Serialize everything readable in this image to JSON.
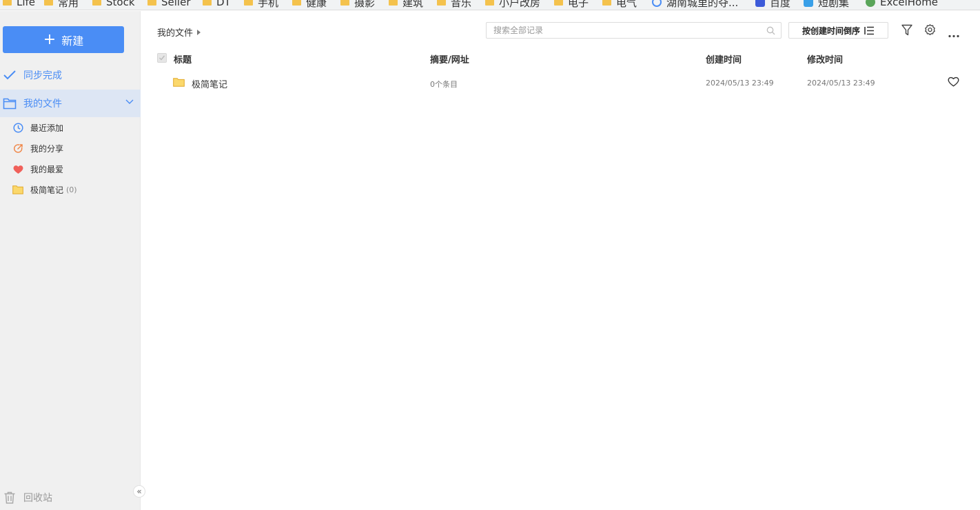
{
  "bookmarks": [
    {
      "label": "Life",
      "type": "folder"
    },
    {
      "label": "常用",
      "type": "folder"
    },
    {
      "label": "Stock",
      "type": "folder"
    },
    {
      "label": "Seller",
      "type": "folder"
    },
    {
      "label": "DT",
      "type": "folder"
    },
    {
      "label": "手机",
      "type": "folder"
    },
    {
      "label": "健康",
      "type": "folder"
    },
    {
      "label": "摄影",
      "type": "folder"
    },
    {
      "label": "建筑",
      "type": "folder"
    },
    {
      "label": "音乐",
      "type": "folder"
    },
    {
      "label": "小户改房",
      "type": "folder"
    },
    {
      "label": "电子",
      "type": "folder"
    },
    {
      "label": "电气",
      "type": "folder"
    },
    {
      "label": "湖南城里的夺...",
      "type": "site"
    },
    {
      "label": "百度",
      "type": "site"
    },
    {
      "label": "短剧集",
      "type": "site"
    },
    {
      "label": "ExcelHome",
      "type": "site"
    }
  ],
  "sidebar": {
    "new_label": "新建",
    "sync_label": "同步完成",
    "myfiles_label": "我的文件",
    "items": [
      {
        "label": "最近添加",
        "icon": "clock-icon"
      },
      {
        "label": "我的分享",
        "icon": "share-icon"
      },
      {
        "label": "我的最爱",
        "icon": "heart-icon"
      },
      {
        "label": "极简笔记",
        "icon": "folder-icon",
        "count": "(0)"
      }
    ],
    "recycle_label": "回收站",
    "collapse_glyph": "«"
  },
  "main": {
    "breadcrumb": "我的文件",
    "search_placeholder": "搜索全部记录",
    "sort_label": "按创建时间倒序",
    "columns": {
      "title": "标题",
      "summary": "摘要/网址",
      "created": "创建时间",
      "modified": "修改时间"
    },
    "rows": [
      {
        "name": "极简笔记",
        "summary": "0个条目",
        "created": "2024/05/13 23:49",
        "modified": "2024/05/13 23:49"
      }
    ]
  },
  "colors": {
    "accent": "#4a8df5",
    "sidebar_bg": "#f0f0f0",
    "selected_bg": "#dde6f4",
    "folder": "#f4c24d",
    "heart": "#f0605a",
    "share": "#f0884a"
  }
}
